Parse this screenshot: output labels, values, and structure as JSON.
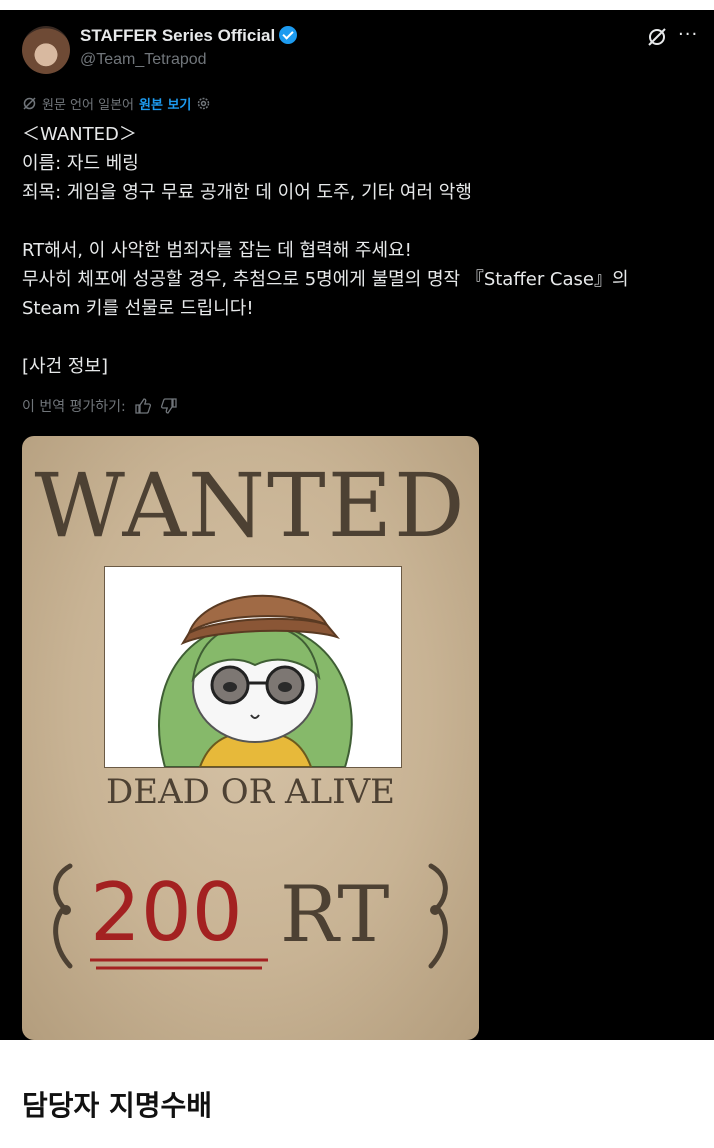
{
  "account": {
    "display_name": "STAFFER Series Official",
    "handle": "@Team_Tetrapod"
  },
  "translation_bar": {
    "source_text": "원문 언어 일본어",
    "show_original": "원본 보기"
  },
  "tweet_lines": [
    "＜WANTED＞",
    "이름: 자드 베링",
    "죄목: 게임을 영구 무료 공개한 데 이어 도주, 기타 여러 악행",
    "",
    "RT해서, 이 사악한 범죄자를 잡는 데 협력해 주세요!",
    "무사히 체포에 성공할 경우, 추첨으로 5명에게 불멸의 명작 『Staffer Case』의",
    "Steam 키를 선물로 드립니다!",
    "",
    "[사건 정보]"
  ],
  "rate_translation": "이 번역 평가하기:",
  "poster": {
    "title": "WANTED",
    "subtitle": "DEAD OR ALIVE",
    "reward_number": "200",
    "reward_unit": "RT"
  },
  "caption": "담당자 지명수배",
  "icons": [
    "verified-badge-icon",
    "grok-icon",
    "more-icon",
    "translate-icon",
    "settings-icon",
    "thumbs-up-icon",
    "thumbs-down-icon"
  ],
  "colors": {
    "background": "#000000",
    "text": "#e7e9ea",
    "muted": "#71767b",
    "accent": "#1d9bf0",
    "poster_paper": "#c8b394",
    "poster_ink": "#4d4133",
    "reward_red": "#a32121"
  }
}
